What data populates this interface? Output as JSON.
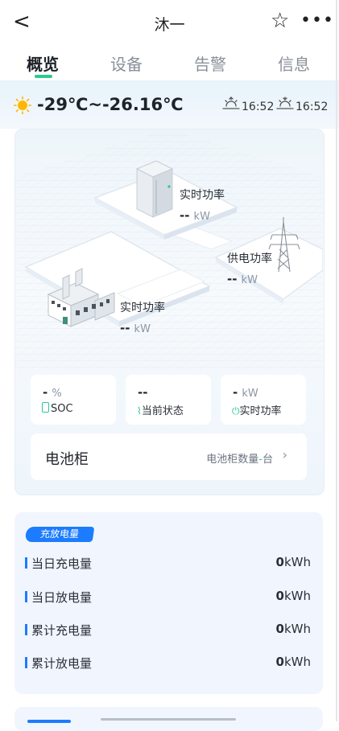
{
  "header": {
    "title": "沐一"
  },
  "tabs": [
    {
      "label": "概览"
    },
    {
      "label": "设备"
    },
    {
      "label": "告警"
    },
    {
      "label": "信息"
    }
  ],
  "weather": {
    "temp_range": "-29℃~-26.16℃",
    "sunrise_time": "16:52",
    "sunset_time": "16:52"
  },
  "diagram": {
    "storage": {
      "label": "实时功率",
      "value": "--",
      "unit": "kW"
    },
    "grid": {
      "label": "供电功率",
      "value": "--",
      "unit": "kW"
    },
    "factory": {
      "label": "实时功率",
      "value": "--",
      "unit": "kW"
    }
  },
  "stats": [
    {
      "value": "-",
      "unit": "%",
      "label": "SOC",
      "icon": "battery-icon"
    },
    {
      "value": "--",
      "unit": "",
      "label": "当前状态",
      "icon": "pulse-icon"
    },
    {
      "value": "-",
      "unit": "kW",
      "label": "实时功率",
      "icon": "power-icon"
    }
  ],
  "battery_cabinet": {
    "title": "电池柜",
    "count_label": "电池柜数量",
    "count_value": "-",
    "count_unit": "台"
  },
  "charge": {
    "badge": "充放电量",
    "rows": [
      {
        "label": "当日充电量",
        "value": "0",
        "unit": "kWh"
      },
      {
        "label": "当日放电量",
        "value": "0",
        "unit": "kWh"
      },
      {
        "label": "累计充电量",
        "value": "0",
        "unit": "kWh"
      },
      {
        "label": "累计放电量",
        "value": "0",
        "unit": "kWh"
      }
    ]
  },
  "colors": {
    "accent": "#2cc98f",
    "primary": "#1c7cff",
    "sun": "#ffb800"
  }
}
